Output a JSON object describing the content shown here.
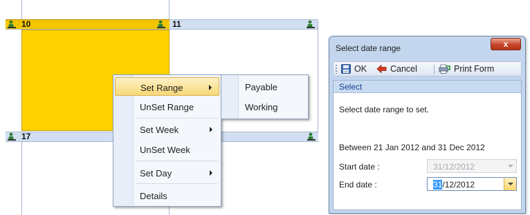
{
  "calendar": {
    "days": [
      {
        "label": "10",
        "selected": true
      },
      {
        "label": "11",
        "selected": false
      },
      {
        "label": "17",
        "selected": false
      }
    ],
    "selected_color": "#FFD200",
    "header_color": "#D2DFF2"
  },
  "context_menu": {
    "items": [
      {
        "label": "Set Range",
        "submenu": true,
        "highlighted": true
      },
      {
        "label": "UnSet Range",
        "submenu": false
      },
      {
        "label": "Set Week",
        "submenu": true
      },
      {
        "label": "UnSet Week",
        "submenu": false
      },
      {
        "label": "Set Day",
        "submenu": true
      },
      {
        "label": "Details",
        "submenu": false
      }
    ],
    "submenu_items": [
      {
        "label": "Payable"
      },
      {
        "label": "Working"
      }
    ]
  },
  "dialog": {
    "title": "Select date range",
    "close_label": "x",
    "toolbar": {
      "ok_label": "OK",
      "cancel_label": "Cancel",
      "print_label": "Print Form"
    },
    "group_title": "Select",
    "instruction": "Select date range to set.",
    "range_text": "Between 21 Jan 2012 and 31 Dec 2012",
    "start_label": "Start date :",
    "start_value": "31/12/2012",
    "end_label": "End date :",
    "end_value_selected": "31",
    "end_value_rest": "/12/2012"
  }
}
